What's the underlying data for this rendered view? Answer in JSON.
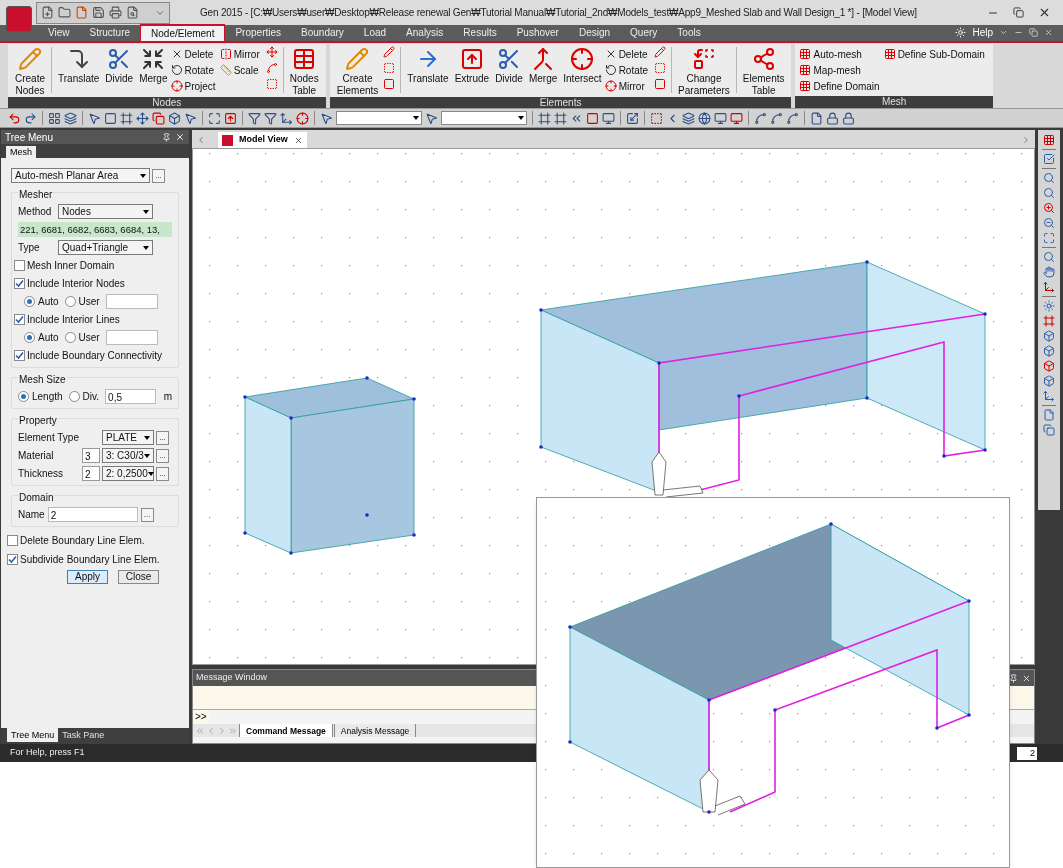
{
  "title": "Gen 2015 - [C:₩Users₩user₩Desktop₩Release renewal Gen₩Tutorial Manual₩Tutorial_2nd₩Models_test₩App9_Meshed Slab and Wall Design_1 *] - [Model View]",
  "ribbon_tabs": [
    {
      "label": "View",
      "selected": false
    },
    {
      "label": "Structure",
      "selected": false
    },
    {
      "label": "Node/Element",
      "selected": true
    },
    {
      "label": "Properties",
      "selected": false
    },
    {
      "label": "Boundary",
      "selected": false
    },
    {
      "label": "Load",
      "selected": false
    },
    {
      "label": "Analysis",
      "selected": false
    },
    {
      "label": "Results",
      "selected": false
    },
    {
      "label": "Pushover",
      "selected": false
    },
    {
      "label": "Design",
      "selected": false
    },
    {
      "label": "Query",
      "selected": false
    },
    {
      "label": "Tools",
      "selected": false
    }
  ],
  "help": "Help",
  "ribbon_groups": [
    {
      "title": "Nodes",
      "items": [
        {
          "kind": "large",
          "label": "Create Nodes"
        },
        {
          "kind": "divider"
        },
        {
          "kind": "large",
          "label": "Translate"
        },
        {
          "kind": "large",
          "label": "Divide"
        },
        {
          "kind": "large",
          "label": "Merge"
        },
        {
          "kind": "small",
          "labels": [
            "Delete",
            "Rotate",
            "Project"
          ]
        },
        {
          "kind": "small",
          "labels": [
            "Mirror",
            "Scale"
          ]
        },
        {
          "kind": "icons"
        },
        {
          "kind": "divider"
        },
        {
          "kind": "large",
          "label": "Nodes Table"
        }
      ]
    },
    {
      "title": "Elements",
      "items": [
        {
          "kind": "large",
          "label": "Create Elements"
        },
        {
          "kind": "icons"
        },
        {
          "kind": "divider"
        },
        {
          "kind": "large",
          "label": "Translate"
        },
        {
          "kind": "large",
          "label": "Extrude"
        },
        {
          "kind": "large",
          "label": "Divide"
        },
        {
          "kind": "large",
          "label": "Merge"
        },
        {
          "kind": "large",
          "label": "Intersect"
        },
        {
          "kind": "small",
          "labels": [
            "Delete",
            "Rotate",
            "Mirror"
          ]
        },
        {
          "kind": "icons"
        },
        {
          "kind": "divider"
        },
        {
          "kind": "large",
          "label": "Change Parameters"
        },
        {
          "kind": "divider"
        },
        {
          "kind": "large",
          "label": "Elements Table"
        }
      ]
    },
    {
      "title": "Mesh",
      "items": [
        {
          "kind": "small",
          "labels": [
            "Auto-mesh",
            "Map-mesh",
            "Define Domain"
          ]
        },
        {
          "kind": "small",
          "labels": [
            "Define Sub-Domain"
          ]
        }
      ]
    }
  ],
  "panel": {
    "title": "Tree Menu",
    "tabs": [
      {
        "label": "Mesh",
        "selected": true
      }
    ],
    "function": "Auto-mesh Planar Area",
    "function_more": "...",
    "sections": [
      {
        "title": "Mesher",
        "rows": [
          {
            "kind": "select",
            "label": "Method",
            "value": "Nodes"
          },
          {
            "kind": "list",
            "value": "221, 6681, 6682, 6683, 6684, 13,"
          },
          {
            "kind": "select",
            "label": "Type",
            "value": "Quad+Triangle"
          },
          {
            "kind": "check",
            "label": "Mesh Inner Domain",
            "checked": false
          },
          {
            "kind": "check",
            "label": "Include Interior Nodes",
            "checked": true
          },
          {
            "kind": "radios",
            "options": [
              {
                "label": "Auto",
                "selected": true
              },
              {
                "label": "User",
                "selected": false
              }
            ]
          },
          {
            "kind": "check",
            "label": "Include Interior Lines",
            "checked": true
          },
          {
            "kind": "radios",
            "options": [
              {
                "label": "Auto",
                "selected": true
              },
              {
                "label": "User",
                "selected": false
              }
            ]
          },
          {
            "kind": "check",
            "label": "Include Boundary Connectivity",
            "checked": true
          }
        ]
      },
      {
        "title": "Mesh Size",
        "rows": [
          {
            "kind": "radios",
            "options": [
              {
                "label": "Length",
                "selected": true
              },
              {
                "label": "Div.",
                "selected": false
              }
            ],
            "value": "0,5",
            "unit": "m"
          }
        ]
      },
      {
        "title": "Property",
        "rows": [
          {
            "kind": "select",
            "label": "Element Type",
            "value": "PLATE",
            "more": "..."
          },
          {
            "kind": "select",
            "label": "Material",
            "number": "3",
            "value": "3: C30/3",
            "more": "..."
          },
          {
            "kind": "select",
            "label": "Thickness",
            "number": "2",
            "value": "2: 0,2500",
            "more": "..."
          }
        ]
      },
      {
        "title": "Domain",
        "rows": [
          {
            "kind": "input",
            "label": "Name",
            "value": "2",
            "more": "..."
          }
        ]
      }
    ],
    "checks": [
      {
        "label": "Delete Boundary Line Elem.",
        "checked": false
      },
      {
        "label": "Subdivide Boundary Line Elem.",
        "checked": true
      }
    ],
    "buttons": [
      "Apply",
      "Close"
    ],
    "bottom_tabs": [
      {
        "label": "Tree Menu",
        "selected": true
      },
      {
        "label": "Task Pane",
        "selected": false
      }
    ]
  },
  "view_tabs": [
    {
      "label": "Model View",
      "selected": true
    }
  ],
  "message_window": {
    "title": "Message Window",
    "prompt": ">>",
    "tabs": [
      {
        "label": "Command Message",
        "selected": true
      },
      {
        "label": "Analysis Message",
        "selected": false
      }
    ]
  },
  "status_bar": {
    "text": "For Help, press F1",
    "field": "2"
  }
}
